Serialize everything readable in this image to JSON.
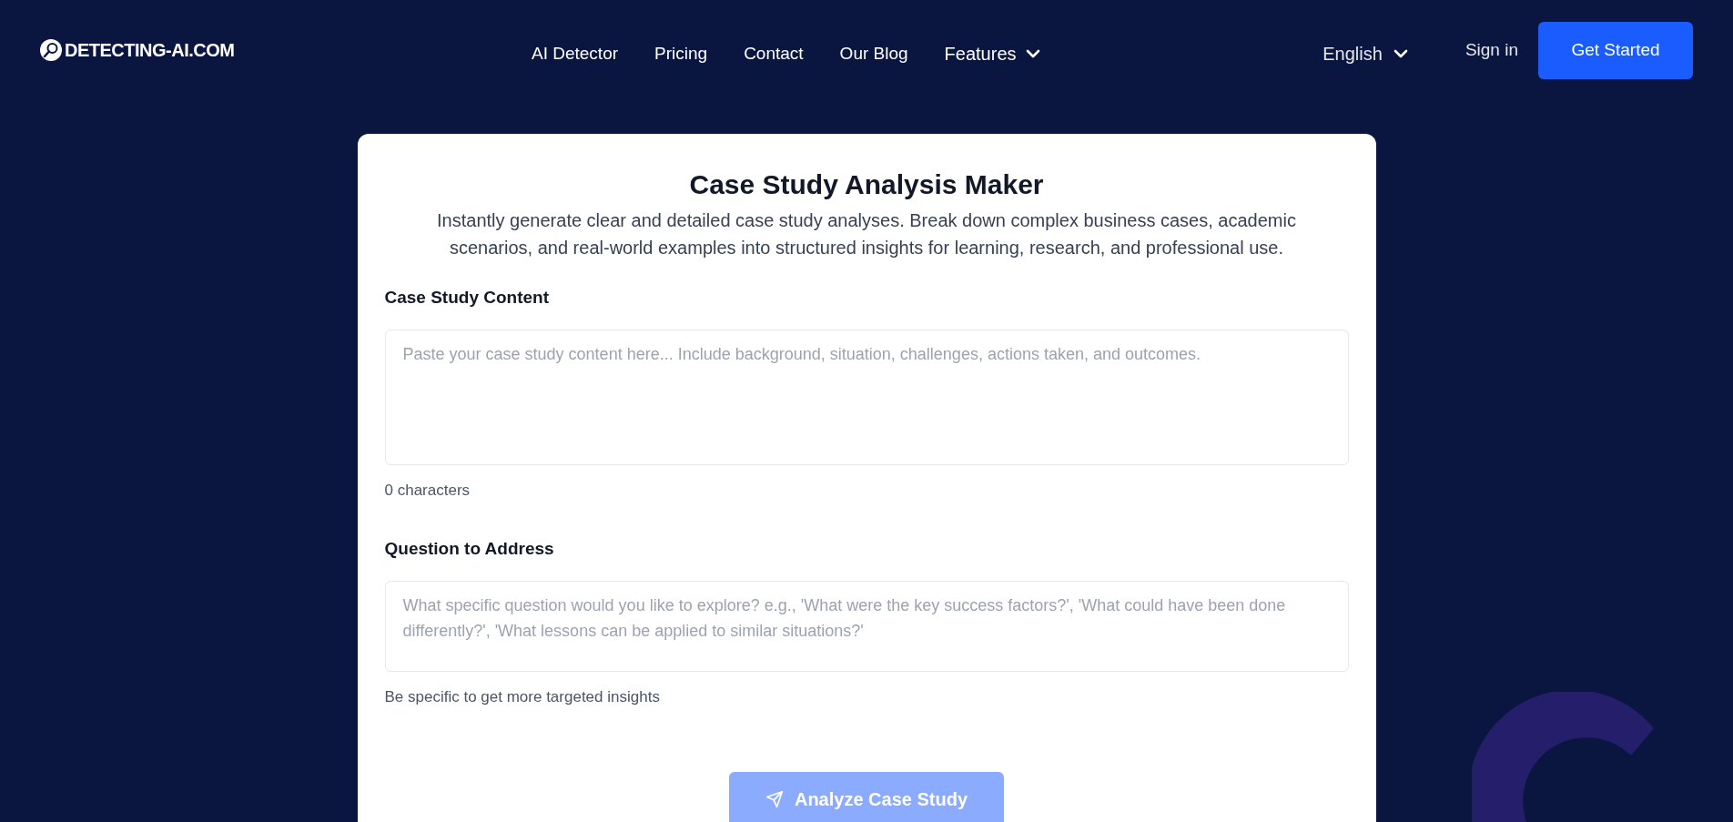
{
  "header": {
    "logo": "DETECTING-AI.COM",
    "nav": [
      {
        "label": "AI Detector",
        "has_menu": false
      },
      {
        "label": "Pricing",
        "has_menu": false
      },
      {
        "label": "Contact",
        "has_menu": false
      },
      {
        "label": "Our Blog",
        "has_menu": false
      },
      {
        "label": "Features",
        "has_menu": true
      }
    ],
    "language": "English",
    "sign_in": "Sign in",
    "cta": "Get Started"
  },
  "card": {
    "title": "Case Study Analysis Maker",
    "subtitle": "Instantly generate clear and detailed case study analyses. Break down complex business cases, academic scenarios, and real-world examples into structured insights for learning, research, and professional use.",
    "fields": [
      {
        "label": "Case Study Content",
        "placeholder": "Paste your case study content here... Include background, situation, challenges, actions taken, and outcomes.",
        "note": "0 characters",
        "kind": "large"
      },
      {
        "label": "Question to Address",
        "placeholder": "What specific question would you like to explore? e.g., 'What were the key success factors?', 'What could have been done differently?', 'What lessons can be applied to similar situations?'",
        "note": "Be specific to get more targeted insights",
        "kind": "small"
      }
    ],
    "submit": {
      "label": "Analyze Case Study",
      "disabled": true
    }
  }
}
